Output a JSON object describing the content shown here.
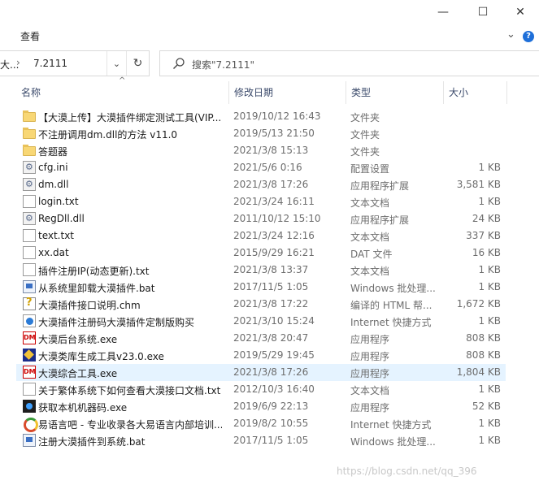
{
  "window": {
    "min_glyph": "—",
    "max_glyph": "☐",
    "close_glyph": "✕"
  },
  "ribbon": {
    "tab_view": "查看",
    "chevron": "⌄",
    "help": "?"
  },
  "address": {
    "crumb_first": "大...",
    "separator": "›",
    "current": "7.2111",
    "dropdown": "⌄",
    "refresh": "↻"
  },
  "search": {
    "placeholder": "搜索\"7.2111\""
  },
  "columns": {
    "name": "名称",
    "date": "修改日期",
    "type": "类型",
    "size": "大小",
    "sort_arrow": "^"
  },
  "files": [
    {
      "icon": "folder-icon",
      "name": "【大漠上传】大漠插件绑定测试工具(VIP...",
      "date": "2019/10/12 16:43",
      "type": "文件夹",
      "size": ""
    },
    {
      "icon": "folder-icon",
      "name": "不注册调用dm.dll的方法 v11.0",
      "date": "2019/5/13 21:50",
      "type": "文件夹",
      "size": ""
    },
    {
      "icon": "folder-icon",
      "name": "答题器",
      "date": "2021/3/8 15:13",
      "type": "文件夹",
      "size": ""
    },
    {
      "icon": "settings-file-icon",
      "name": "cfg.ini",
      "date": "2021/5/6 0:16",
      "type": "配置设置",
      "size": "1 KB"
    },
    {
      "icon": "dll-file-icon",
      "name": "dm.dll",
      "date": "2021/3/8 17:26",
      "type": "应用程序扩展",
      "size": "3,581 KB"
    },
    {
      "icon": "text-file-icon",
      "name": "login.txt",
      "date": "2021/3/24 16:11",
      "type": "文本文档",
      "size": "1 KB"
    },
    {
      "icon": "dll-file-icon",
      "name": "RegDll.dll",
      "date": "2011/10/12 15:10",
      "type": "应用程序扩展",
      "size": "24 KB"
    },
    {
      "icon": "text-file-icon",
      "name": "text.txt",
      "date": "2021/3/24 12:16",
      "type": "文本文档",
      "size": "337 KB"
    },
    {
      "icon": "blank-file-icon",
      "name": "xx.dat",
      "date": "2015/9/29 16:21",
      "type": "DAT 文件",
      "size": "16 KB"
    },
    {
      "icon": "text-file-icon",
      "name": "插件注册IP(动态更新).txt",
      "date": "2021/3/8 13:37",
      "type": "文本文档",
      "size": "1 KB"
    },
    {
      "icon": "batch-file-icon",
      "name": "从系统里卸载大漠插件.bat",
      "date": "2017/11/5 1:05",
      "type": "Windows 批处理...",
      "size": "1 KB"
    },
    {
      "icon": "help-file-icon",
      "name": "大漠插件接口说明.chm",
      "date": "2021/3/8 17:22",
      "type": "编译的 HTML 帮...",
      "size": "1,672 KB"
    },
    {
      "icon": "internet-shortcut-icon",
      "name": "大漠插件注册码大漠插件定制版购买",
      "date": "2021/3/10 15:24",
      "type": "Internet 快捷方式",
      "size": "1 KB"
    },
    {
      "icon": "dm-app-icon",
      "name": "大漠后台系统.exe",
      "date": "2021/3/8 20:47",
      "type": "应用程序",
      "size": "808 KB"
    },
    {
      "icon": "tool-app-icon",
      "name": "大漠类库生成工具v23.0.exe",
      "date": "2019/5/29 19:45",
      "type": "应用程序",
      "size": "808 KB"
    },
    {
      "icon": "dm-app-icon",
      "name": "大漠综合工具.exe",
      "date": "2021/3/8 17:26",
      "type": "应用程序",
      "size": "1,804 KB",
      "selected": true
    },
    {
      "icon": "text-file-icon",
      "name": "关于繁体系统下如何查看大漠接口文档.txt",
      "date": "2012/10/3 16:40",
      "type": "文本文档",
      "size": "1 KB"
    },
    {
      "icon": "machine-code-app-icon",
      "name": "获取本机机器码.exe",
      "date": "2019/6/9 22:13",
      "type": "应用程序",
      "size": "52 KB"
    },
    {
      "icon": "browser-shortcut-icon",
      "name": "易语言吧 - 专业收录各大易语言内部培训...",
      "date": "2019/8/2 10:55",
      "type": "Internet 快捷方式",
      "size": "1 KB"
    },
    {
      "icon": "batch-file-icon",
      "name": "注册大漠插件到系统.bat",
      "date": "2017/11/5 1:05",
      "type": "Windows 批处理...",
      "size": "1 KB"
    }
  ],
  "watermark": "https://blog.csdn.net/qq_396"
}
